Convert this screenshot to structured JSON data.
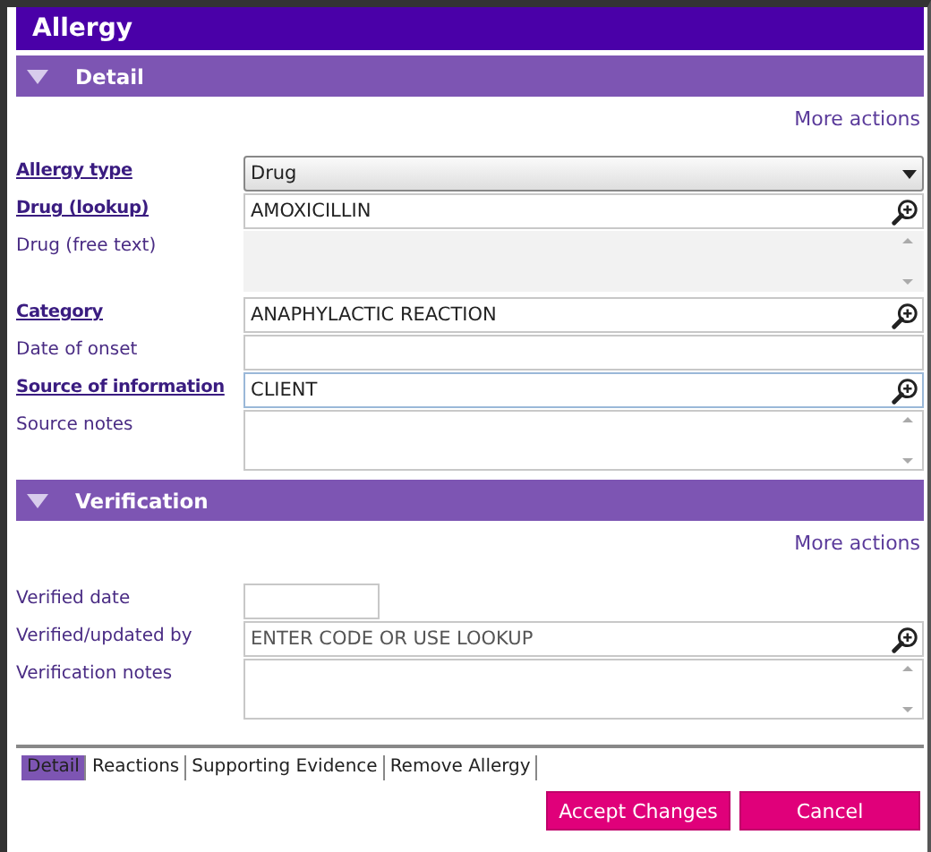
{
  "window": {
    "title": "Allergy"
  },
  "sections": [
    {
      "title": "Detail",
      "expanded": true,
      "more_actions": "More actions",
      "fields": [
        {
          "label": "Allergy type",
          "required": true,
          "kind": "select",
          "value": "Drug"
        },
        {
          "label": "Drug (lookup)",
          "required": true,
          "kind": "lookup",
          "value": "AMOXICILLIN"
        },
        {
          "label": "Drug (free text)",
          "required": false,
          "kind": "textarea",
          "disabled": true
        },
        {
          "label": "Category",
          "required": true,
          "kind": "lookup",
          "value": "ANAPHYLACTIC REACTION"
        },
        {
          "label": "Date of onset",
          "required": false,
          "kind": "text"
        },
        {
          "label": "Source of information",
          "required": true,
          "kind": "lookup",
          "value": "CLIENT",
          "focused": true
        },
        {
          "label": "Source notes",
          "required": false,
          "kind": "textarea",
          "disabled": false
        }
      ]
    },
    {
      "title": "Verification",
      "expanded": true,
      "more_actions": "More actions",
      "fields": [
        {
          "label": "Verified date",
          "required": false,
          "kind": "date"
        },
        {
          "label": "Verified/updated by",
          "required": false,
          "kind": "lookup",
          "placeholder": "ENTER CODE OR USE LOOKUP"
        },
        {
          "label": "Verification notes",
          "required": false,
          "kind": "textarea",
          "disabled": false
        }
      ]
    }
  ],
  "tabs": [
    {
      "label": "Detail",
      "selected": true
    },
    {
      "label": "Reactions",
      "selected": false
    },
    {
      "label": "Supporting Evidence",
      "selected": false
    },
    {
      "label": "Remove Allergy",
      "selected": false
    }
  ],
  "buttons": [
    "Accept Changes",
    "Cancel"
  ]
}
